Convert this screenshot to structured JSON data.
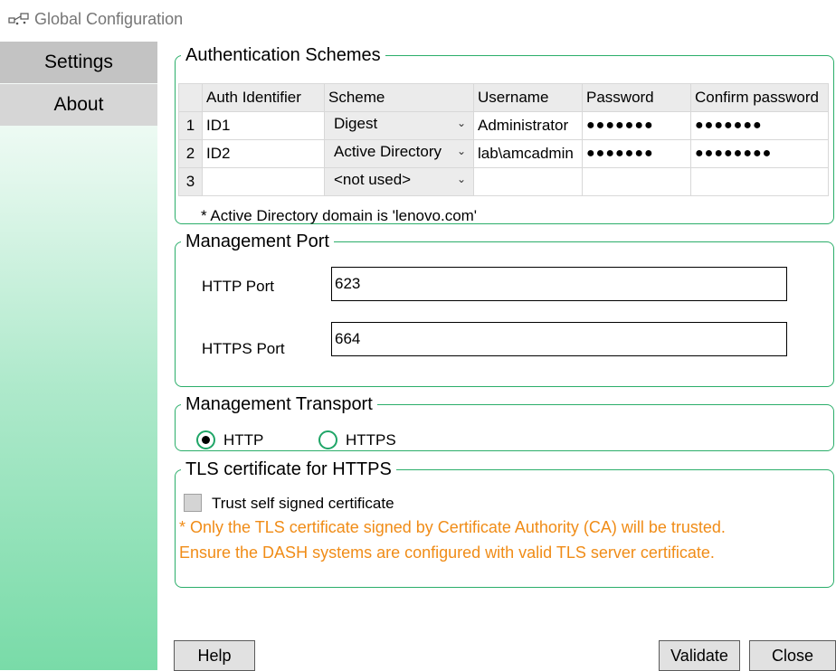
{
  "window": {
    "title": "Global Configuration",
    "icon": "app-icon"
  },
  "sidebar": {
    "items": [
      {
        "label": "Settings",
        "active": true
      },
      {
        "label": "About",
        "active": false
      }
    ]
  },
  "auth": {
    "legend": "Authentication Schemes",
    "columns": [
      "Auth Identifier",
      "Scheme",
      "Username",
      "Password",
      "Confirm password"
    ],
    "rows": [
      {
        "num": "1",
        "id": "ID1",
        "scheme": "Digest",
        "username": "Administrator",
        "password": "●●●●●●●",
        "confirm": "●●●●●●●"
      },
      {
        "num": "2",
        "id": "ID2",
        "scheme": "Active Directory",
        "username": "lab\\amcadmin",
        "password": "●●●●●●●",
        "confirm": "●●●●●●●●"
      },
      {
        "num": "3",
        "id": "",
        "scheme": "<not used>",
        "username": "",
        "password": "",
        "confirm": ""
      }
    ],
    "note": "* Active Directory domain is 'lenovo.com'"
  },
  "port": {
    "legend": "Management Port",
    "http_label": "HTTP Port",
    "http_value": "623",
    "https_label": "HTTPS Port",
    "https_value": "664"
  },
  "transport": {
    "legend": "Management Transport",
    "options": [
      {
        "label": "HTTP",
        "selected": true
      },
      {
        "label": "HTTPS",
        "selected": false
      }
    ]
  },
  "tls": {
    "legend": "TLS certificate for HTTPS",
    "checkbox_label": "Trust self signed certificate",
    "checked": false,
    "warning_line1": "* Only the TLS certificate signed by Certificate Authority (CA) will be trusted.",
    "warning_line2": "Ensure the DASH systems are configured with valid TLS server certificate."
  },
  "buttons": {
    "help": "Help",
    "validate": "Validate",
    "close": "Close"
  },
  "colors": {
    "accent_border": "#2bae6a",
    "radio": "#1fa567",
    "warning": "#f08c17",
    "sidebar_bottom": "#79dba8"
  }
}
